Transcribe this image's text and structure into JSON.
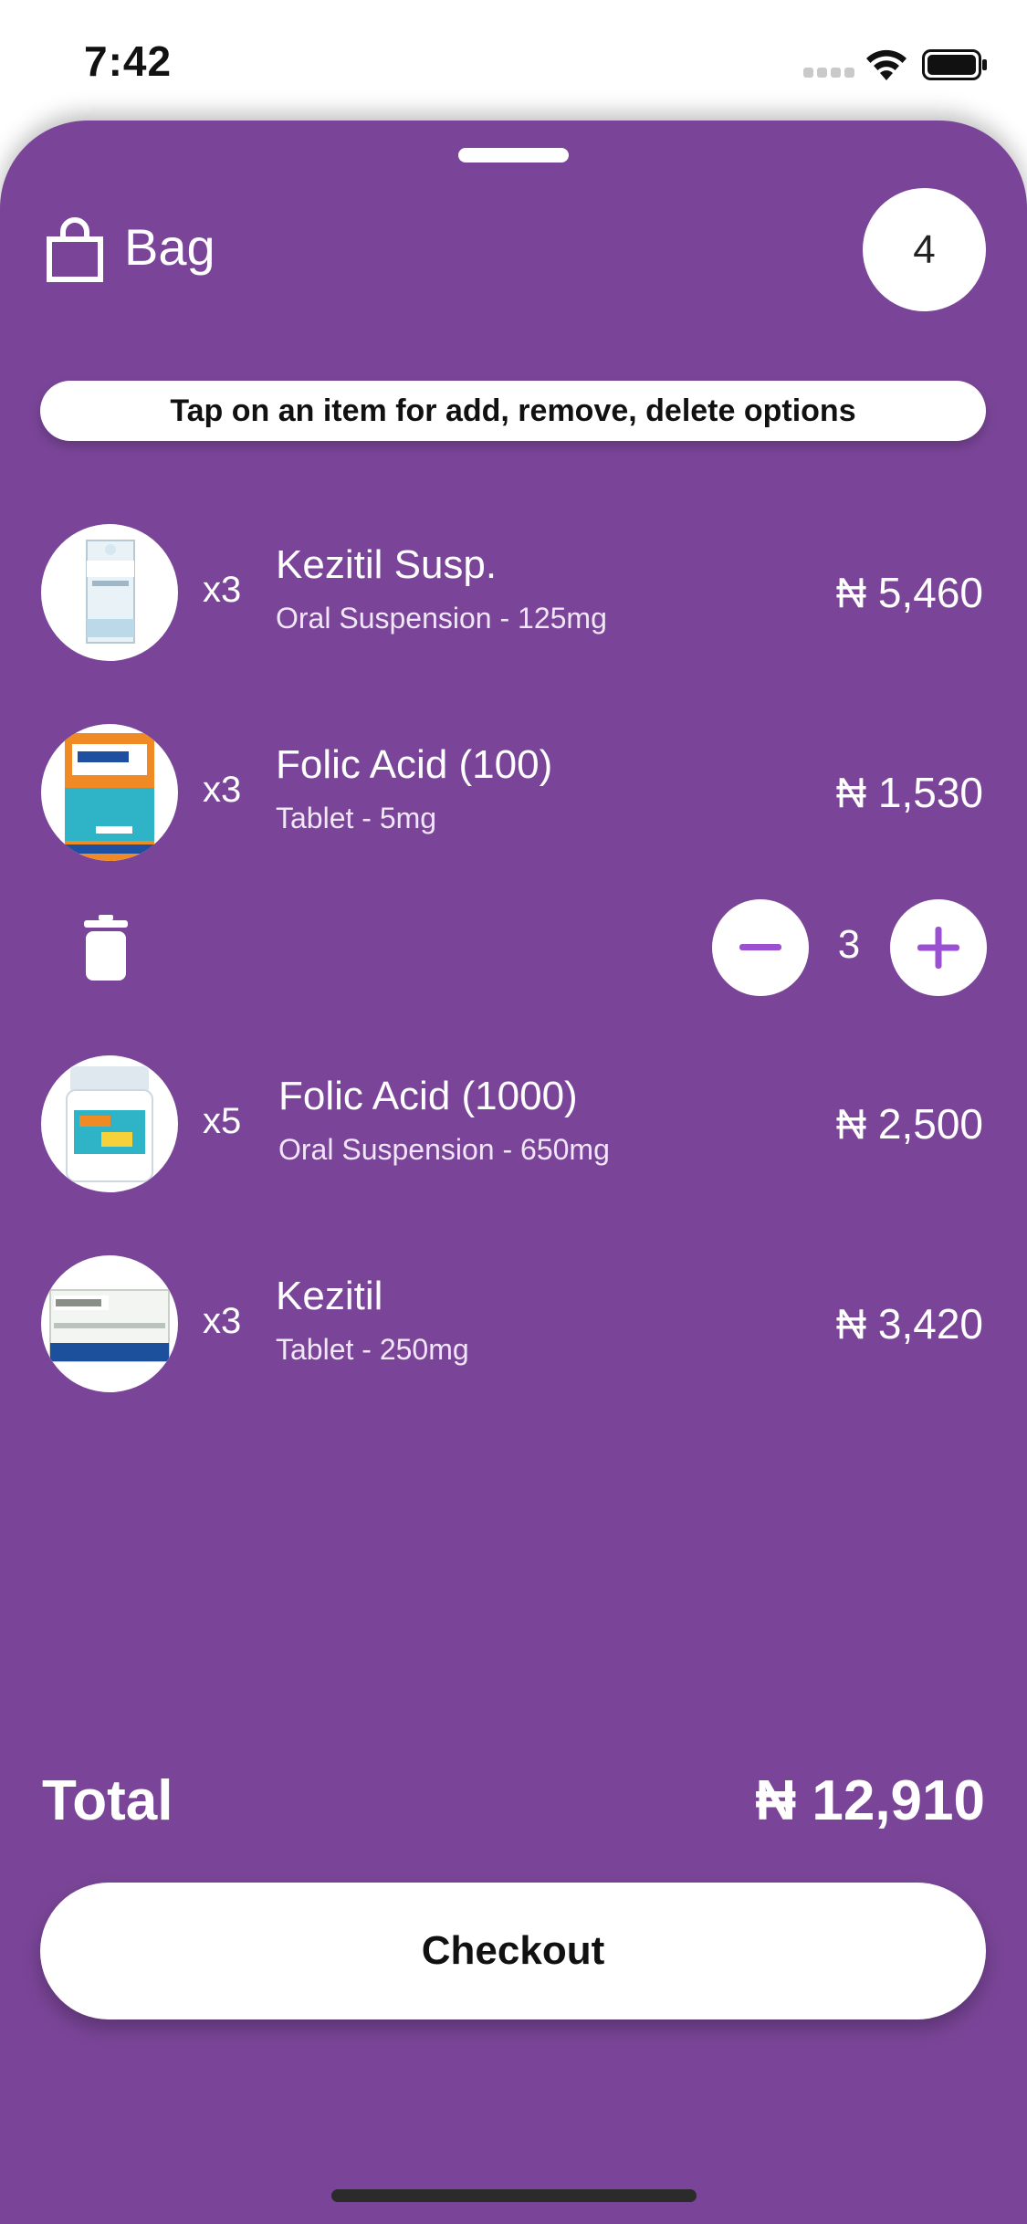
{
  "status_bar": {
    "time": "7:42"
  },
  "bag": {
    "title": "Bag",
    "count": "4"
  },
  "hint": "Tap on an item for add, remove, delete options",
  "items": [
    {
      "qty": "x3",
      "name": "Kezitil Susp.",
      "detail": "Oral Suspension - 125mg",
      "price": "₦ 5,460",
      "image": "kezitil-suspension-box"
    },
    {
      "qty": "x3",
      "name": "Folic Acid (100)",
      "detail": "Tablet - 5mg",
      "price": "₦ 1,530",
      "image": "folic-acid-box"
    },
    {
      "qty": "x5",
      "name": "Folic Acid (1000)",
      "detail": "Oral Suspension - 650mg",
      "price": "₦ 2,500",
      "image": "folic-acid-jar"
    },
    {
      "qty": "x3",
      "name": "Kezitil",
      "detail": "Tablet - 250mg",
      "price": "₦ 3,420",
      "image": "kezitil-tablet-box"
    }
  ],
  "stepper": {
    "value": "3"
  },
  "total": {
    "label": "Total",
    "value": "₦ 12,910"
  },
  "checkout_label": "Checkout",
  "colors": {
    "sheet": "#7a4598",
    "accent": "#9b4fd1",
    "surface": "#ffffff"
  }
}
